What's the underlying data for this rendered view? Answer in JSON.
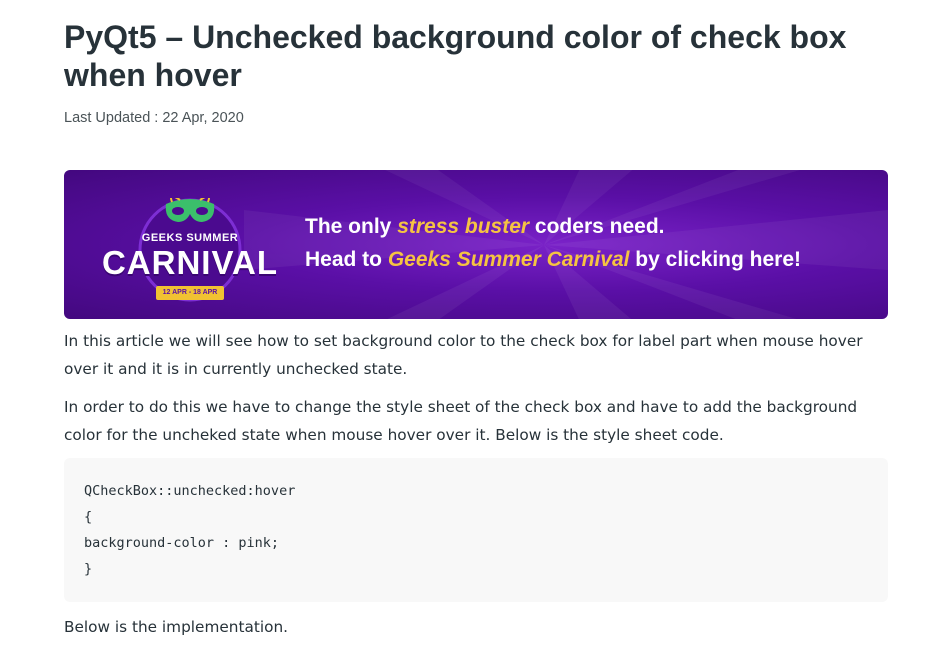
{
  "article": {
    "title": "PyQt5 – Unchecked background color of check box when hover",
    "last_updated": "Last Updated : 22 Apr, 2020",
    "banner": {
      "logo_top": "GEEKS SUMMER",
      "logo_main": "CARNIVAL",
      "logo_dates": "12 APR - 18 APR",
      "line1_pre": "The only ",
      "line1_hl": "stress buster",
      "line1_post": " coders need.",
      "line2_pre": "Head to ",
      "line2_hl": "Geeks Summer Carnival",
      "line2_post": " by clicking here!"
    },
    "paragraphs": [
      "In this article we will see how to set background color to the check box for label part when mouse hover over it and it is in currently unchecked state.",
      "In order to do this we have to change the style sheet of the check box and have to add the background color for the uncheked state when mouse hover over it. Below is the style sheet code.",
      "Below is the implementation."
    ],
    "code": "QCheckBox::unchecked:hover\n{\nbackground-color : pink;\n}"
  },
  "colors": {
    "text": "#273239",
    "banner_purple": "#5a0fa6",
    "highlight_yellow": "#f5c342",
    "code_bg": "#f8f8f8"
  }
}
